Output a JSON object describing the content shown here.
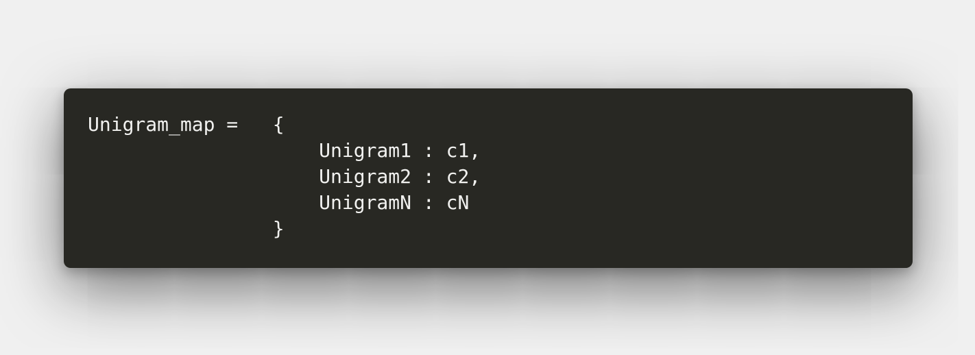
{
  "code": {
    "lines": [
      "Unigram_map =   {",
      "                    Unigram1 : c1,",
      "                    Unigram2 : c2,",
      "                    UnigramN : cN",
      "                }"
    ]
  },
  "colors": {
    "page_background": "#f0f0f0",
    "card_background": "#282823",
    "code_text": "#f1f1ef"
  }
}
